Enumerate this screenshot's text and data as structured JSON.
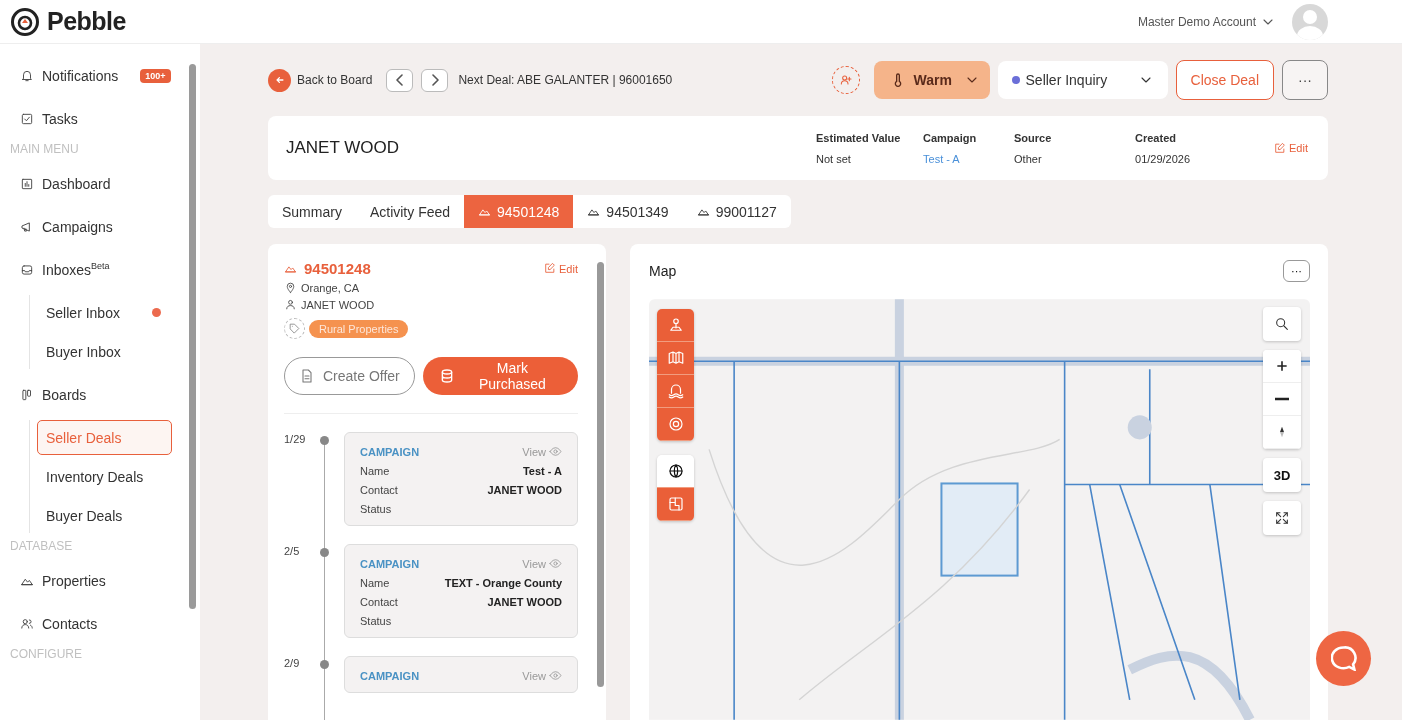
{
  "app": {
    "logo": "Pebble",
    "account": "Master Demo Account"
  },
  "sidebar": {
    "items": [
      {
        "kind": "item",
        "label": "Notifications",
        "badge": "100+",
        "selected": false
      },
      {
        "kind": "item",
        "label": "Tasks",
        "selected": false
      },
      {
        "kind": "section",
        "label": "MAIN MENU"
      },
      {
        "kind": "item",
        "label": "Dashboard",
        "selected": false
      },
      {
        "kind": "item",
        "label": "Campaigns",
        "selected": false
      },
      {
        "kind": "item",
        "label": "Inboxes$^{Beta}$",
        "selected": false,
        "children": [
          {
            "label": "Seller Inbox",
            "unread": true,
            "selected": false
          },
          {
            "label": "Buyer Inbox",
            "unread": false,
            "selected": false
          }
        ]
      },
      {
        "kind": "item",
        "label": "Boards",
        "selected": false,
        "children": [
          {
            "label": "Seller Deals",
            "unread": false,
            "selected": true
          },
          {
            "label": "Inventory Deals",
            "unread": false,
            "selected": false
          },
          {
            "label": "Buyer Deals",
            "unread": false,
            "selected": false
          }
        ]
      },
      {
        "kind": "section",
        "label": "DATABASE"
      },
      {
        "kind": "item",
        "label": "Properties",
        "selected": false
      },
      {
        "kind": "item",
        "label": "Contacts",
        "selected": false
      },
      {
        "kind": "section",
        "label": "CONFIGURE"
      }
    ]
  },
  "deal_bar": {
    "back": "Back to Board",
    "next_deal": "Next Deal: ABE GALANTER | 96001650",
    "temperature": "Warm",
    "stage": {
      "label": "Seller Inquiry",
      "color": "#6b6fd8"
    },
    "close": "Close Deal",
    "more": "···"
  },
  "contact": {
    "name": "JANET WOOD",
    "edit": "Edit",
    "fields": [
      {
        "label": "Estimated Value",
        "value": "Not set",
        "kind": "text"
      },
      {
        "label": "Campaign",
        "value": "Test - A",
        "kind": "link"
      },
      {
        "label": "Source",
        "value": "Other",
        "kind": "text"
      },
      {
        "label": "Created",
        "value": "01/29/2026",
        "kind": "text"
      }
    ]
  },
  "tabs": [
    {
      "label": "Summary",
      "kind": "text",
      "selected": false
    },
    {
      "label": "Activity Feed",
      "kind": "text",
      "selected": false
    },
    {
      "label": "94501248",
      "kind": "property",
      "selected": true
    },
    {
      "label": "94501349",
      "kind": "property",
      "selected": false
    },
    {
      "label": "99001127",
      "kind": "property",
      "selected": false
    }
  ],
  "property": {
    "id": "94501248",
    "edit": "Edit",
    "location": "Orange, CA",
    "owner": "JANET WOOD",
    "tag": "Rural Properties",
    "create_offer": "Create Offer",
    "mark_purchased": "Mark Purchased",
    "timeline": [
      {
        "date": "1/29",
        "type": "CAMPAIGN",
        "view": "View",
        "rows": [
          {
            "label": "Name",
            "value": "Test - A"
          },
          {
            "label": "Contact",
            "value": "JANET WOOD"
          },
          {
            "label": "Status"
          }
        ]
      },
      {
        "date": "2/5",
        "type": "CAMPAIGN",
        "view": "View",
        "rows": [
          {
            "label": "Name",
            "value": "TEXT - Orange County"
          },
          {
            "label": "Contact",
            "value": "JANET WOOD"
          },
          {
            "label": "Status"
          }
        ]
      },
      {
        "date": "2/9",
        "type": "CAMPAIGN",
        "view": "View"
      }
    ]
  },
  "map": {
    "title": "Map",
    "more": "···",
    "layer_tools": [
      {
        "selected": true
      },
      {
        "selected": true
      },
      {
        "selected": true
      },
      {
        "selected": true
      }
    ],
    "base_tools": [
      {
        "selected": false
      },
      {
        "selected": true
      }
    ],
    "view_3d": "3D"
  }
}
